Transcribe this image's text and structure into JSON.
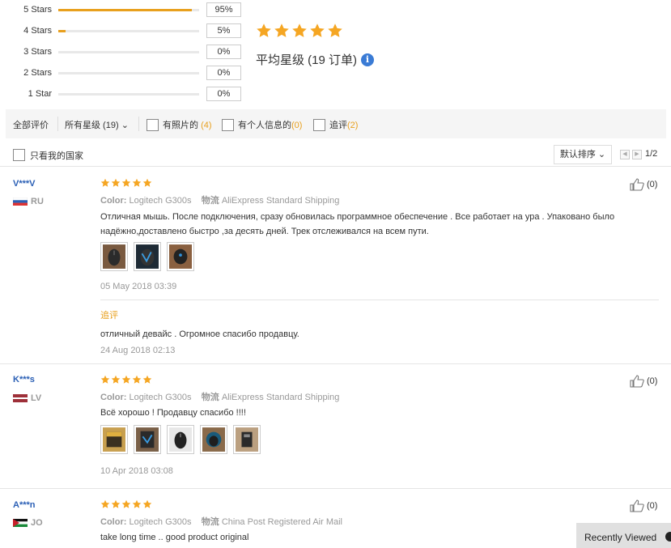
{
  "histogram": [
    {
      "label": "5 Stars",
      "fraction": 0.95,
      "pct": "95%"
    },
    {
      "label": "4 Stars",
      "fraction": 0.05,
      "pct": "5%"
    },
    {
      "label": "3 Stars",
      "fraction": 0,
      "pct": "0%"
    },
    {
      "label": "2 Stars",
      "fraction": 0,
      "pct": "0%"
    },
    {
      "label": "1 Star",
      "fraction": 0,
      "pct": "0%"
    }
  ],
  "average": {
    "stars": 5,
    "text": "平均星级 (19 订单)"
  },
  "filters": {
    "all": "全部评价",
    "all_stars": "所有星级 (19)",
    "photos": "有照片的",
    "photos_count": "(4)",
    "personal": "有个人信息的",
    "personal_count": "(0)",
    "followup": "追评",
    "followup_count": "(2)",
    "my_country": "只看我的国家",
    "sort": "默认排序",
    "page": "1/2"
  },
  "reviews": [
    {
      "user": "V***V",
      "country": "RU",
      "stars": 5,
      "color_label": "Color:",
      "color": "Logitech G300s",
      "logistics_label": "物流",
      "logistics": "AliExpress Standard Shipping",
      "text": "Отличная мышь. После подключения, сразу обновилась программное обеспечение . Все работает на ура . Упаковано было надёжно,доставлено быстро ,за десять дней. Трек отслеживался на всем пути.",
      "date": "05 May 2018 03:39",
      "followup_label": "追评",
      "followup_text": "отличный девайс . Огромное спасибо продавцу.",
      "followup_date": "24 Aug 2018 02:13",
      "likes": "(0)"
    },
    {
      "user": "K***s",
      "country": "LV",
      "stars": 5,
      "color_label": "Color:",
      "color": "Logitech G300s",
      "logistics_label": "物流",
      "logistics": "AliExpress Standard Shipping",
      "text": "Всё хорошо ! Продавцу спасибо !!!!",
      "date": "10 Apr 2018 03:08",
      "likes": "(0)"
    },
    {
      "user": "A***n",
      "country": "JO",
      "stars": 5,
      "color_label": "Color:",
      "color": "Logitech G300s",
      "logistics_label": "物流",
      "logistics": "China Post Registered Air Mail",
      "text": "take long time .. good product original",
      "likes": "(0)"
    }
  ],
  "recently_viewed": "Recently Viewed",
  "colors": {
    "star": "#f5a623",
    "link": "#2a5fb5",
    "accent": "#e8a01e"
  }
}
